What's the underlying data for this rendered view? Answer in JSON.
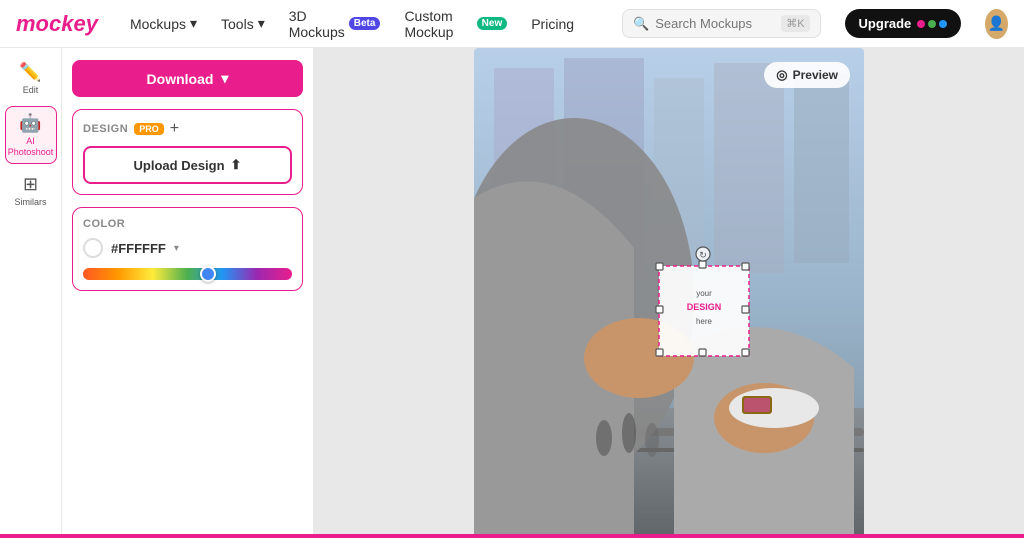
{
  "header": {
    "logo": "mockey",
    "nav": [
      {
        "id": "mockups",
        "label": "Mockups",
        "hasDropdown": true
      },
      {
        "id": "tools",
        "label": "Tools",
        "hasDropdown": true
      },
      {
        "id": "3d-mockups",
        "label": "3D Mockups",
        "badge": "Beta",
        "badgeType": "beta"
      },
      {
        "id": "custom-mockup",
        "label": "Custom Mockup",
        "badge": "New",
        "badgeType": "new"
      },
      {
        "id": "pricing",
        "label": "Pricing"
      }
    ],
    "search": {
      "placeholder": "Search Mockups",
      "shortcut": "⌘K"
    },
    "upgrade_label": "Upgrade"
  },
  "sidebar": {
    "items": [
      {
        "id": "edit",
        "label": "Edit",
        "icon": "✏️"
      },
      {
        "id": "ai-photoshoot",
        "label": "AI\nPhotoshoot",
        "icon": "🤖",
        "active": true
      },
      {
        "id": "similars",
        "label": "Similars",
        "icon": "⊞"
      }
    ]
  },
  "panel": {
    "download_label": "Download",
    "design_section": {
      "title": "DESIGN",
      "pro_label": "PRO",
      "add_label": "+",
      "upload_label": "Upload Design"
    },
    "color_section": {
      "title": "COLOR",
      "hex_value": "#FFFFFF"
    }
  },
  "preview": {
    "badge_label": "Preview",
    "design_text": "your\nDESIGN\nhere"
  }
}
